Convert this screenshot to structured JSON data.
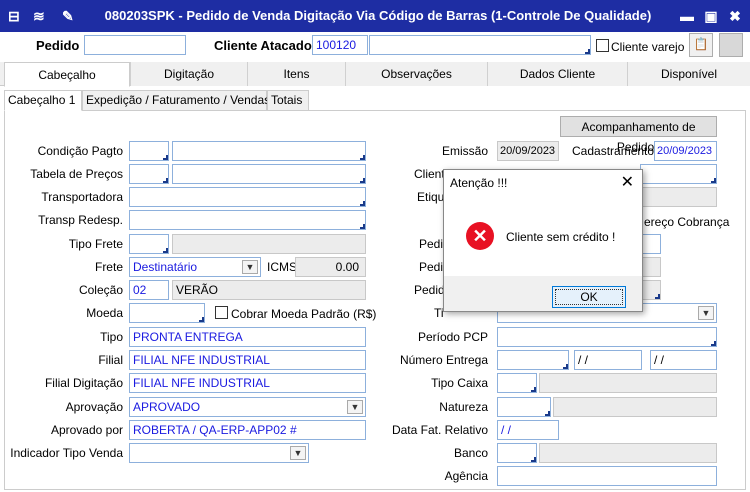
{
  "window": {
    "title": "080203SPK - Pedido de Venda Digitação Via Código de Barras (1-Controle De Qualidade)",
    "title_color": "#1e2da3"
  },
  "header": {
    "pedido_label": "Pedido",
    "pedido_value": "",
    "cliente_atacado_label": "Cliente Atacado",
    "cliente_atacado_value": "100120",
    "cliente_nome_value": "",
    "cliente_varejo_label": "Cliente varejo"
  },
  "tabs": [
    "Cabeçalho",
    "Digitação",
    "Itens",
    "Observações",
    "Dados Cliente",
    "Disponível"
  ],
  "subtabs": [
    "Cabeçalho 1",
    "Expedição / Faturamento / Vendas",
    "Totais"
  ],
  "buttons": {
    "acompanhamento": "Acompanhamento de Pedidos"
  },
  "left": {
    "condicao_pagto": "Condição Pagto",
    "tabela_precos": "Tabela de Preços",
    "transportadora": "Transportadora",
    "transp_redesp": "Transp Redesp.",
    "tipo_frete": "Tipo Frete",
    "frete": "Frete",
    "frete_value": "Destinatário",
    "icms": "ICMS",
    "icms_value": "0.00",
    "colecao": "Coleção",
    "colecao_code": "02",
    "colecao_value": "VERÃO",
    "moeda": "Moeda",
    "cobrar_moeda": "Cobrar Moeda Padrão (R$)",
    "tipo": "Tipo",
    "tipo_value": "PRONTA ENTREGA",
    "filial": "Filial",
    "filial_value": "FILIAL NFE INDUSTRIAL",
    "filial_digitacao": "Filial Digitação",
    "filial_digitacao_value": "FILIAL NFE INDUSTRIAL",
    "aprovacao": "Aprovação",
    "aprovacao_value": "APROVADO",
    "aprovado_por": "Aprovado por",
    "aprovado_por_value": "ROBERTA / QA-ERP-APP02 #",
    "indicador_tipo_venda": "Indicador Tipo Venda"
  },
  "right": {
    "emissao": "Emissão",
    "emissao_value": "20/09/2023",
    "cadastramento": "Cadastramento",
    "cadastramento_value": "20/09/2023",
    "cliente_partial": "Client",
    "etiq_partial": "Etiqu",
    "endereco_cobranca_partial": "ereço Cobrança",
    "pedi_1": "Pedid",
    "pedi_2": "Pedid",
    "pedi_3": "Pedid",
    "ti_partial": "Ti",
    "periodo_pcp": "Período PCP",
    "numero_entrega": "Número Entrega",
    "numero_entrega_d1": " / /",
    "numero_entrega_d2": " / /",
    "tipo_caixa": "Tipo Caixa",
    "natureza": "Natureza",
    "data_fat_relativo": "Data Fat. Relativo",
    "data_fat_value": " / /",
    "banco": "Banco",
    "agencia": "Agência"
  },
  "dialog": {
    "title": "Atenção !!!",
    "message": "Cliente sem crédito !",
    "ok_label": "OK",
    "icon": "error-icon"
  }
}
